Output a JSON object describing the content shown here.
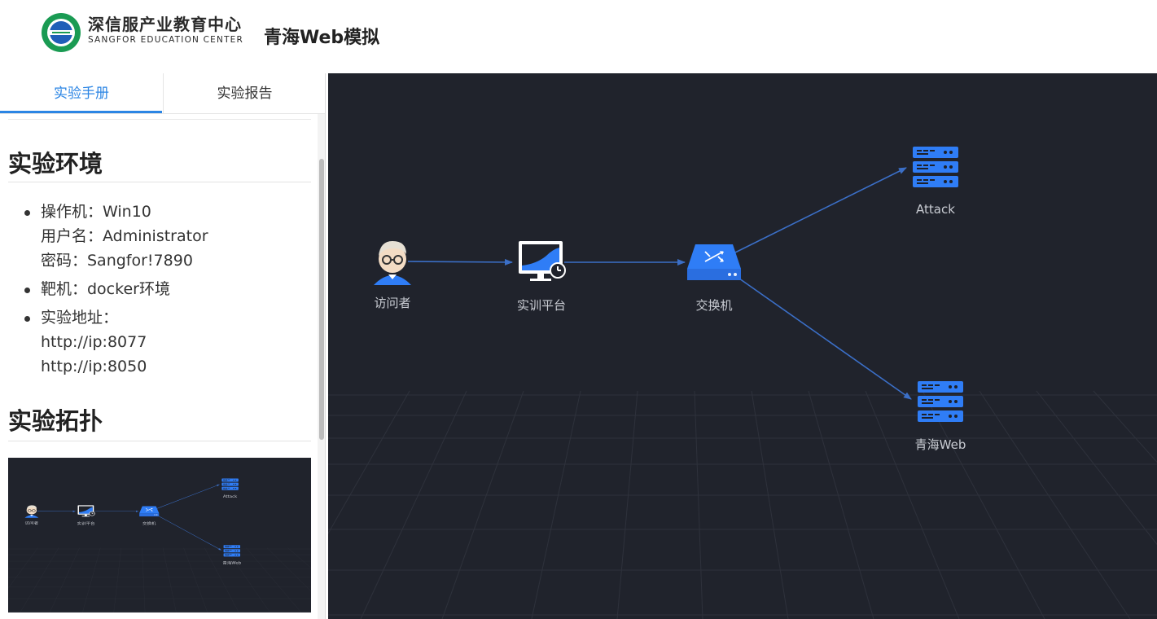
{
  "header": {
    "brand_cn": "深信服产业教育中心",
    "brand_en": "SANGFOR EDUCATION CENTER",
    "app_title": "青海Web模拟"
  },
  "tabs": [
    {
      "label": "实验手册",
      "active": true
    },
    {
      "label": "实验报告",
      "active": false
    }
  ],
  "manual": {
    "section_env": "实验环境",
    "env_items": [
      {
        "lines": [
          "操作机：Win10",
          "用户名：Administrator",
          "密码：Sangfor!7890"
        ]
      },
      {
        "lines": [
          "靶机：docker环境"
        ]
      },
      {
        "lines": [
          "实验地址：",
          "http://ip:8077",
          "http://ip:8050"
        ]
      }
    ],
    "section_topo": "实验拓扑"
  },
  "topology": {
    "nodes": [
      {
        "id": "visitor",
        "label": "访问者",
        "icon": "person-icon"
      },
      {
        "id": "platform",
        "label": "实训平台",
        "icon": "monitor-clock-icon"
      },
      {
        "id": "switch",
        "label": "交换机",
        "icon": "switch-icon"
      },
      {
        "id": "attack",
        "label": "Attack",
        "icon": "server-icon"
      },
      {
        "id": "qinghai",
        "label": "青海Web",
        "icon": "server-icon"
      }
    ],
    "links": [
      [
        "visitor",
        "platform"
      ],
      [
        "platform",
        "switch"
      ],
      [
        "switch",
        "attack"
      ],
      [
        "switch",
        "qinghai"
      ]
    ],
    "colors": {
      "accent": "#2b85e4",
      "node_blue": "#2f7df6",
      "link": "#3b6fc7",
      "label": "#c9ccd3"
    }
  }
}
